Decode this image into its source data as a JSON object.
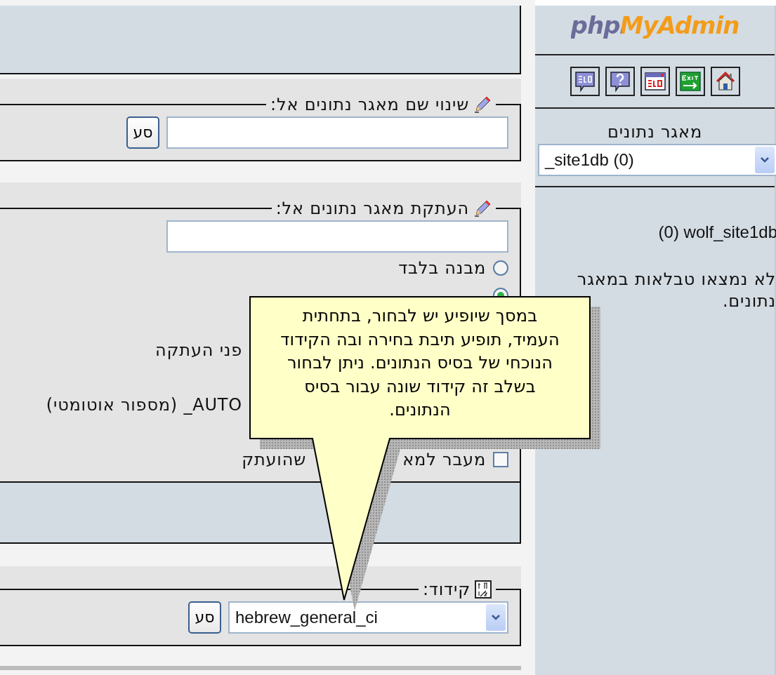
{
  "sidebar": {
    "logo": "phpMyAdmin",
    "toolbar": [
      {
        "kind": "sql"
      },
      {
        "kind": "help"
      },
      {
        "kind": "sqlwindow"
      },
      {
        "kind": "exit"
      },
      {
        "kind": "home"
      }
    ],
    "database_label": "מאגר נתונים",
    "database_select": {
      "value": "_site1db (0)"
    },
    "database_name": "(0) wolf_site1db",
    "message": "לא נמצאו טבלאות במאגר נתונים."
  },
  "rename": {
    "legend": "שינוי שם מאגר נתונים אל:",
    "button": "סע"
  },
  "copy": {
    "legend": "העתקת מאגר נתונים אל:",
    "rows": [
      {
        "kind": "radio",
        "label": "מבנה בלבד",
        "selected": false
      },
      {
        "kind": "radio",
        "selected": true
      },
      {
        "kind": "blank"
      },
      {
        "kind": "text",
        "parts": [
          "פני העתקה"
        ]
      },
      {
        "kind": "blank"
      },
      {
        "kind": "text",
        "parts": [
          "AUTO_ (מספור אוטומטי)"
        ]
      },
      {
        "kind": "blank"
      },
      {
        "kind": "checkbox",
        "checked": false,
        "parts": [
          "מעבר למא",
          "שהועתק"
        ]
      }
    ]
  },
  "charset": {
    "legend": "קידוד:",
    "select": {
      "value": "hebrew_general_ci"
    },
    "button": "סע"
  },
  "callout": {
    "text": "במסך שיופיע יש לבחור, בתחתית העמיד, תופיע תיבת בחירה ובה הקידוד הנוכחי של בסיס הנתונים. ניתן לבחור בשלב זה קידוד שונה עבור בסיס הנתונים."
  }
}
